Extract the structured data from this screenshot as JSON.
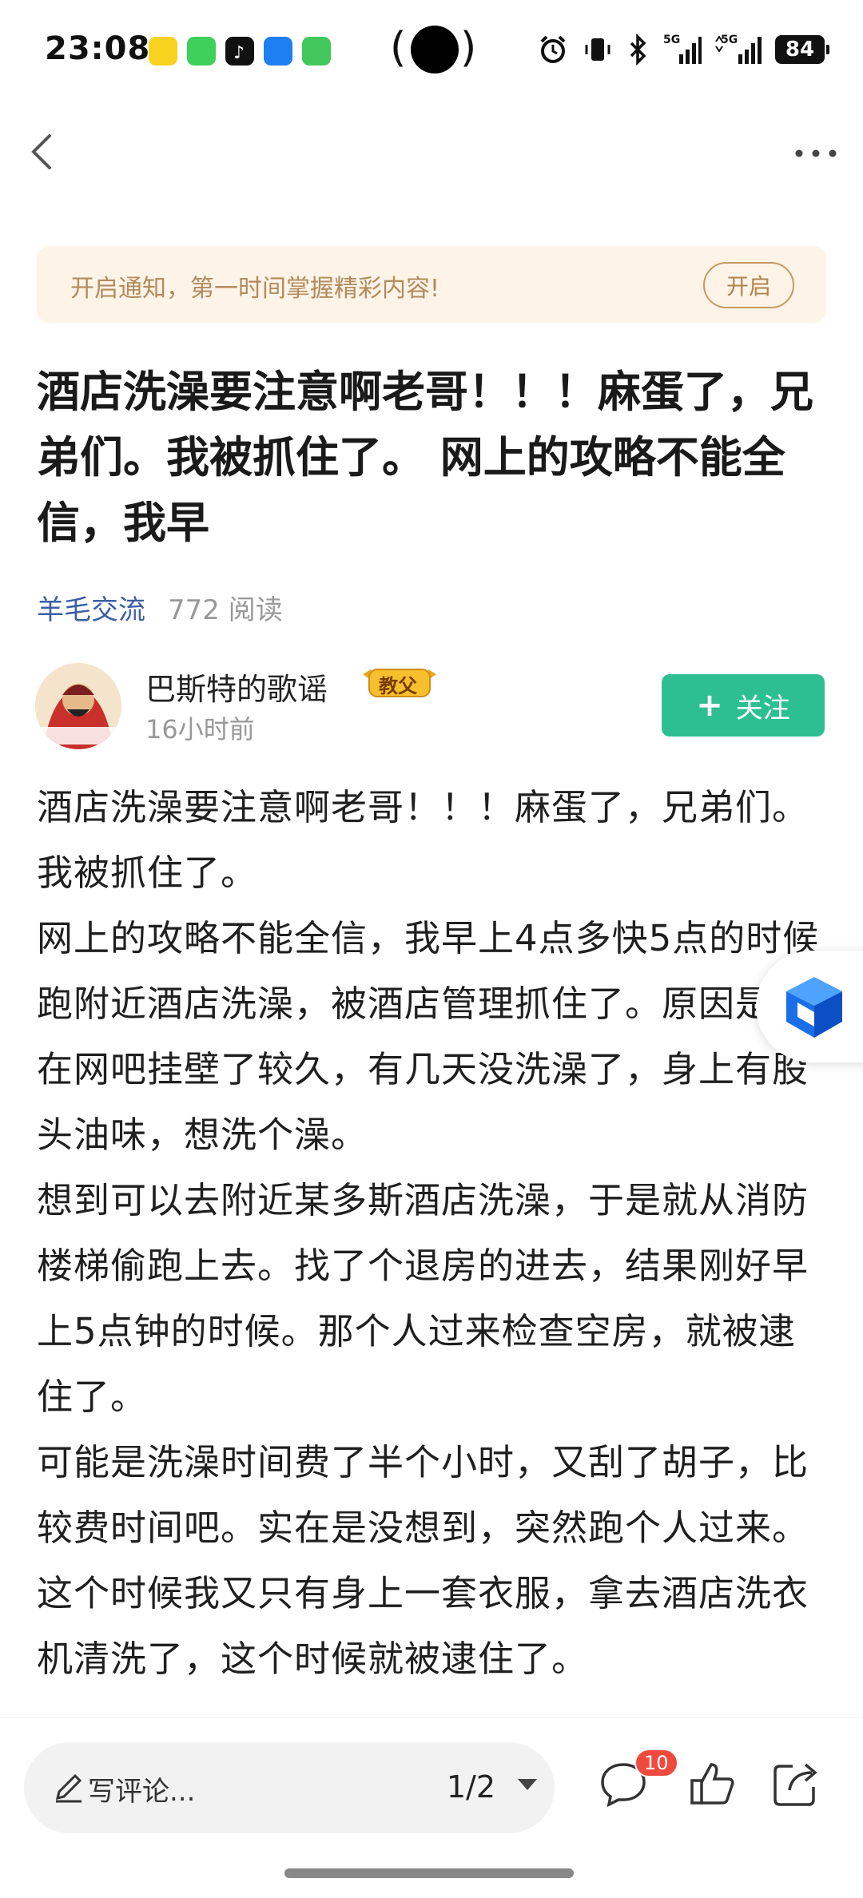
{
  "status_bar": {
    "time": "23:08",
    "signal_label": "5G",
    "battery": "84",
    "icons": [
      "app-icon-yellow",
      "messages-icon",
      "tiktok-icon",
      "wifi-app-icon",
      "phone-icon",
      "alarm-icon",
      "vibrate-icon",
      "bluetooth-icon",
      "signal-icon"
    ]
  },
  "banner": {
    "text": "开启通知，第一时间掌握精彩内容!",
    "button": "开启"
  },
  "article": {
    "title": "酒店洗澡要注意啊老哥！！！麻蛋了，兄弟们。我被抓住了。 网上的攻略不能全信，我早",
    "category": "羊毛交流",
    "reads": "772 阅读",
    "paragraphs": [
      "酒店洗澡要注意啊老哥！！！麻蛋了，兄弟们。我被抓住了。",
      "网上的攻略不能全信，我早上4点多快5点的时候跑附近酒店洗澡，被酒店管理抓住了。原因是我在网吧挂壁了较久，有几天没洗澡了，身上有股头油味，想洗个澡。",
      "想到可以去附近某多斯酒店洗澡，于是就从消防楼梯偷跑上去。找了个退房的进去，结果刚好早上5点钟的时候。那个人过来检查空房，就被逮住了。",
      "可能是洗澡时间费了半个小时，又刮了胡子，比较费时间吧。实在是没想到，突然跑个人过来。",
      "这个时候我又只有身上一套衣服，拿去酒店洗衣机清洗了，这个时候就被逮住了。"
    ]
  },
  "author": {
    "name": "巴斯特的歌谣",
    "badge": "教父",
    "time": "16小时前",
    "follow": "关注",
    "follow_plus": "+"
  },
  "bottom_bar": {
    "comment_placeholder": "写评论...",
    "page": "1/2",
    "comment_count": "10"
  },
  "colors": {
    "accent_green": "#2ebf91",
    "category_blue": "#3b5ea6",
    "banner_bg": "#fdf3e7",
    "badge_red": "#f04a3f"
  }
}
